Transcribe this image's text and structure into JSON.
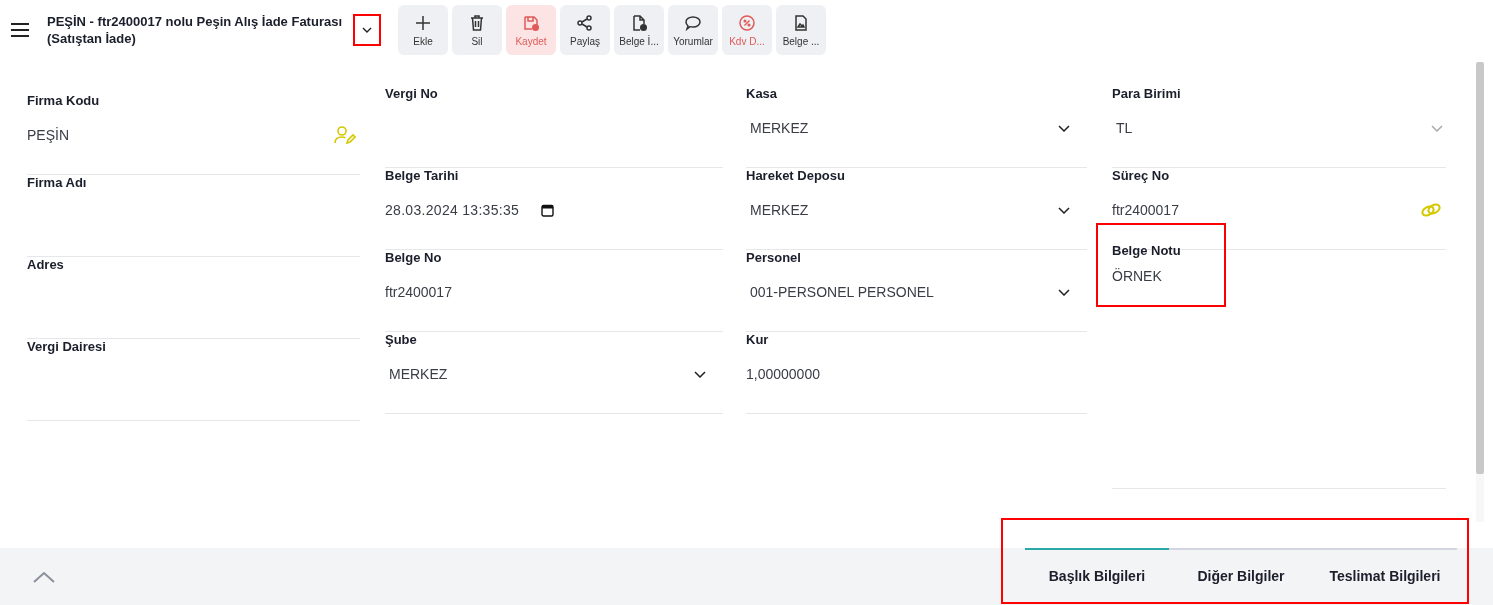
{
  "header": {
    "title": "PEŞİN - ftr2400017 nolu Peşin Alış İade Faturası (Satıştan İade)",
    "dropdown_highlighted": true
  },
  "toolbar": [
    {
      "kind": "add",
      "label": "Ekle"
    },
    {
      "kind": "delete",
      "label": "Sil"
    },
    {
      "kind": "save",
      "label": "Kaydet"
    },
    {
      "kind": "share",
      "label": "Paylaş"
    },
    {
      "kind": "doc-check",
      "label": "Belge İ..."
    },
    {
      "kind": "comment",
      "label": "Yorumlar"
    },
    {
      "kind": "percent",
      "label": "Kdv D..."
    },
    {
      "kind": "doc-image",
      "label": "Belge ..."
    }
  ],
  "columns": [
    [
      {
        "kind": "picker",
        "label": "Firma Kodu",
        "value": "PEŞİN"
      },
      {
        "kind": "text",
        "label": "Firma Adı"
      },
      {
        "kind": "text",
        "label": "Adres"
      },
      {
        "kind": "text",
        "label": "Vergi Dairesi"
      }
    ],
    [
      {
        "kind": "text",
        "label": "Vergi No"
      },
      {
        "kind": "date",
        "label": "Belge Tarihi",
        "value": "28.03.2024 13:35:35"
      },
      {
        "kind": "text",
        "label": "Belge No",
        "value": "ftr2400017"
      },
      {
        "kind": "select",
        "label": "Şube",
        "value": "MERKEZ",
        "disabled": false
      }
    ],
    [
      {
        "kind": "select",
        "label": "Kasa",
        "value": "MERKEZ",
        "disabled": false
      },
      {
        "kind": "select",
        "label": "Hareket Deposu",
        "value": "MERKEZ",
        "disabled": false
      },
      {
        "kind": "select",
        "label": "Personel",
        "value": "001-PERSONEL PERSONEL",
        "disabled": false
      },
      {
        "kind": "text",
        "label": "Kur",
        "value": "1,00000000"
      }
    ],
    [
      {
        "kind": "select",
        "label": "Para Birimi",
        "value": "TL",
        "disabled": true
      },
      {
        "kind": "link",
        "label": "Süreç No",
        "value": "ftr2400017"
      },
      {
        "kind": "note",
        "label": "Belge Notu",
        "value": "ÖRNEK",
        "highlighted": true
      }
    ]
  ],
  "tabs_highlighted": true,
  "tabs": [
    {
      "label": "Başlık Bilgileri",
      "selected": true
    },
    {
      "label": "Diğer Bilgiler",
      "selected": false
    },
    {
      "label": "Teslimat Bilgileri",
      "selected": false
    }
  ]
}
